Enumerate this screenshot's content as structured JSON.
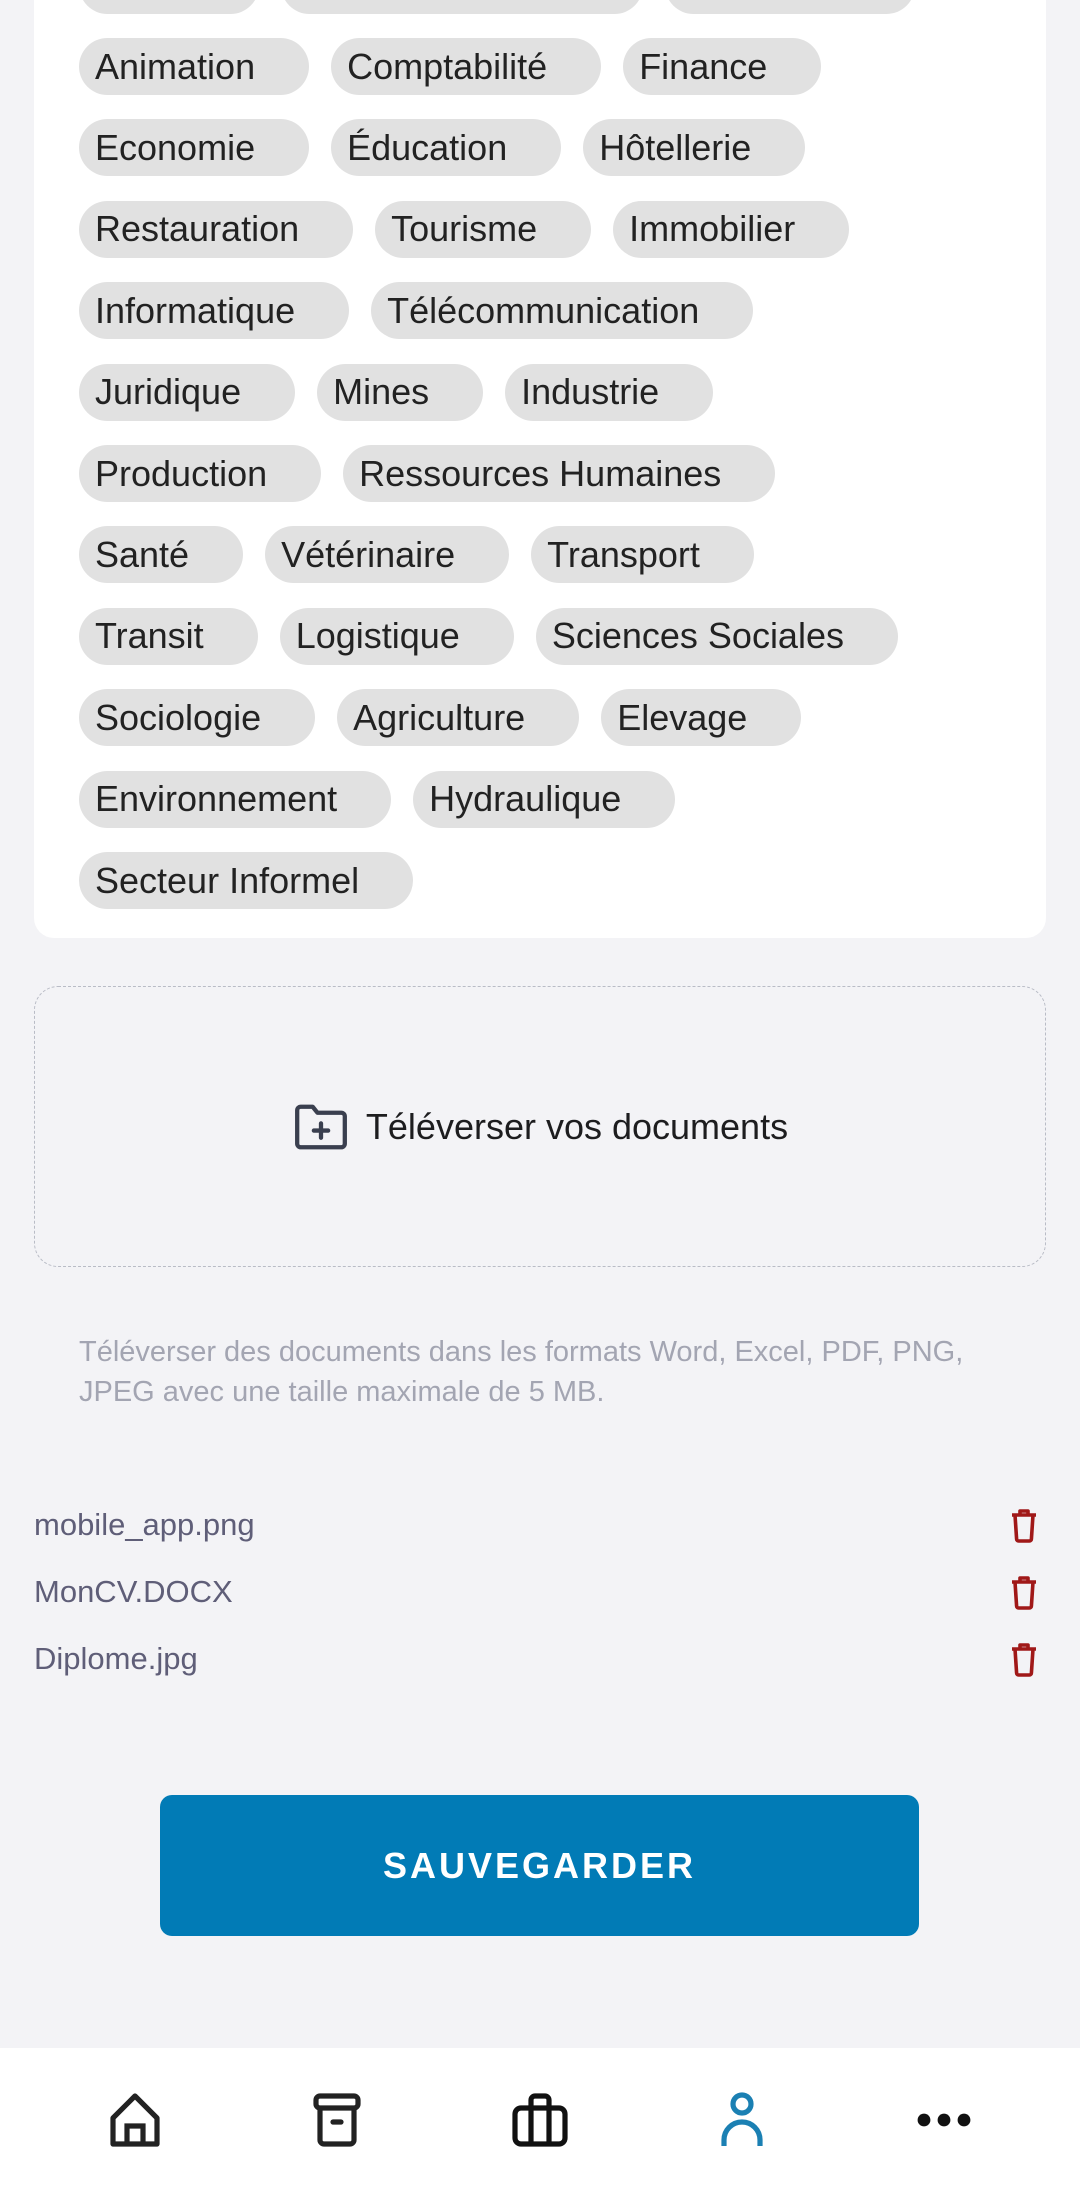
{
  "sectors": [
    "Animation",
    "Comptabilité",
    "Finance",
    "Economie",
    "Éducation",
    "Hôtellerie",
    "Restauration",
    "Tourisme",
    "Immobilier",
    "Informatique",
    "Télécommunication",
    "Juridique",
    "Mines",
    "Industrie",
    "Production",
    "Ressources Humaines",
    "Santé",
    "Vétérinaire",
    "Transport",
    "Transit",
    "Logistique",
    "Sciences Sociales",
    "Sociologie",
    "Agriculture",
    "Elevage",
    "Environnement",
    "Hydraulique",
    "Secteur Informel"
  ],
  "upload": {
    "label": "Téléverser vos documents",
    "icon": "folder-plus-icon",
    "hint": "Téléverser des documents dans les formats Word, Excel, PDF, PNG, JPEG avec une taille maximale de 5 MB."
  },
  "files": [
    {
      "name": "mobile_app.png"
    },
    {
      "name": "MonCV.DOCX"
    },
    {
      "name": "Diplome.jpg"
    }
  ],
  "save_label": "SAUVEGARDER",
  "nav": [
    {
      "icon": "home-icon"
    },
    {
      "icon": "archive-icon"
    },
    {
      "icon": "briefcase-icon"
    },
    {
      "icon": "user-icon",
      "active": true
    },
    {
      "icon": "more-icon"
    }
  ],
  "colors": {
    "accent": "#017bb6",
    "delete": "#a01818",
    "chip": "#e1e1e1"
  }
}
